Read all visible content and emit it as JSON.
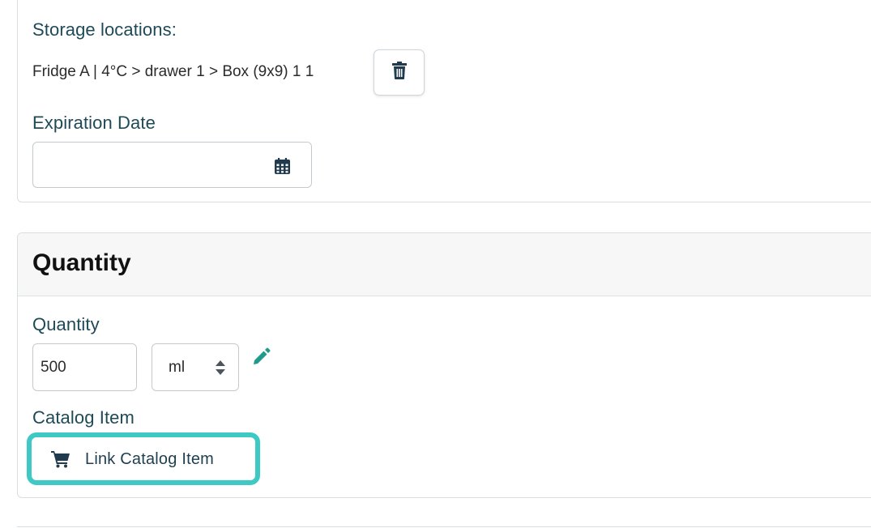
{
  "storage": {
    "label": "Storage locations:",
    "location_text": "Fridge A | 4°C > drawer 1 > Box (9x9) 1 1",
    "delete_icon": "trash-icon"
  },
  "expiration": {
    "label": "Expiration Date",
    "value": "",
    "icon": "calendar-icon"
  },
  "quantity_card": {
    "title": "Quantity",
    "quantity_label": "Quantity",
    "quantity_value": "500",
    "unit_value": "ml",
    "edit_icon": "pencil-icon",
    "catalog_label": "Catalog Item",
    "link_button_label": "Link Catalog Item",
    "link_button_icon": "cart-icon"
  },
  "colors": {
    "label": "#1e4a57",
    "highlight": "#3ec9c5",
    "pencil": "#1f9a8d",
    "card_header_bg": "#f7f7f7"
  }
}
